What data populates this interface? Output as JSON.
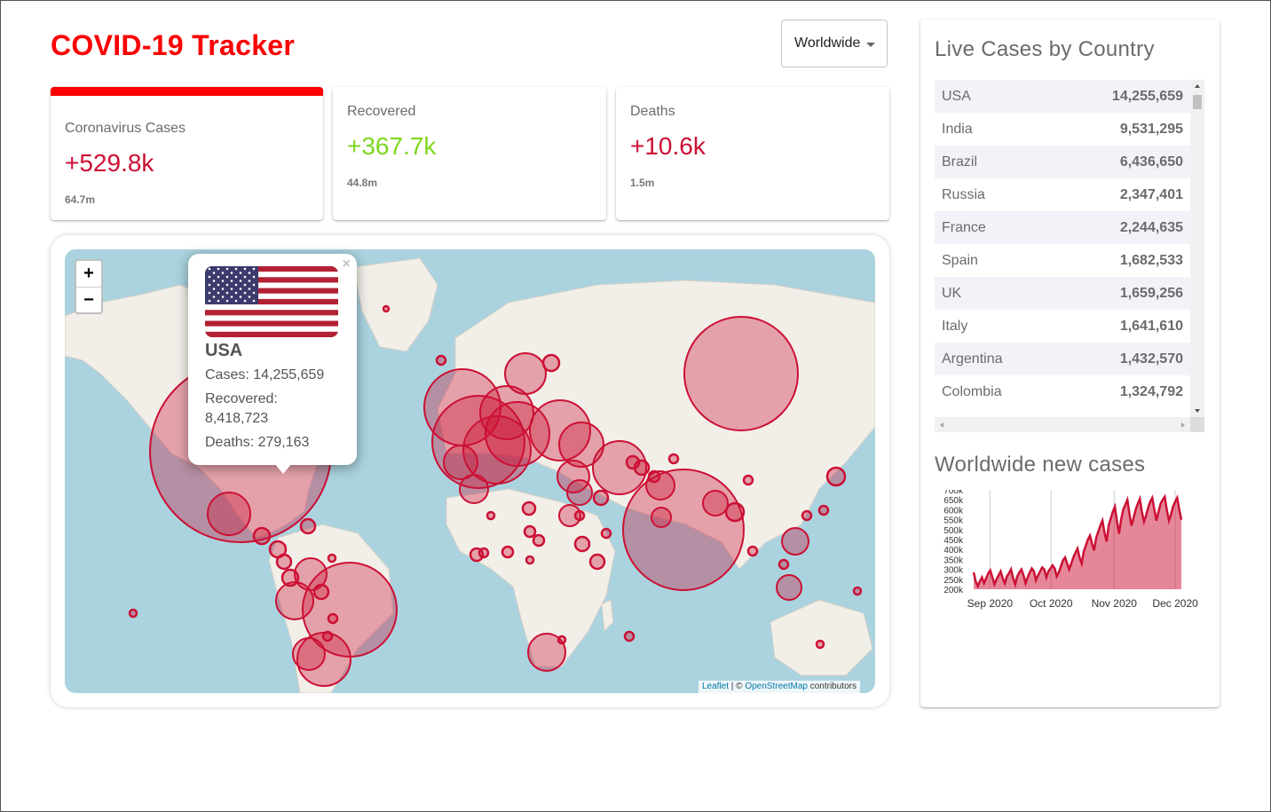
{
  "app": {
    "title": "COVID-19 Tracker"
  },
  "country_select": {
    "value": "Worldwide"
  },
  "info_cards": [
    {
      "title": "Coronavirus Cases",
      "today": "+529.8k",
      "total": "64.7m",
      "color": "#cc1034",
      "selected": true
    },
    {
      "title": "Recovered",
      "today": "+367.7k",
      "total": "44.8m",
      "color": "#7dd71d",
      "selected": false
    },
    {
      "title": "Deaths",
      "today": "+10.6k",
      "total": "1.5m",
      "color": "#cc1034",
      "selected": false
    }
  ],
  "map": {
    "zoom_in": "+",
    "zoom_out": "−",
    "popup": {
      "close": "×",
      "country": "USA",
      "cases": "Cases: 14,255,659",
      "recovered_line1": "Recovered:",
      "recovered_line2": "8,418,723",
      "deaths": "Deaths: 279,163"
    },
    "attribution": {
      "leaflet": "Leaflet",
      "sep": " | © ",
      "osm": "OpenStreetMap",
      "suffix": " contributors"
    },
    "circle_color": "#cc1034"
  },
  "sidebar": {
    "table_title": "Live Cases by Country",
    "countries": [
      {
        "name": "USA",
        "cases": "14,255,659"
      },
      {
        "name": "India",
        "cases": "9,531,295"
      },
      {
        "name": "Brazil",
        "cases": "6,436,650"
      },
      {
        "name": "Russia",
        "cases": "2,347,401"
      },
      {
        "name": "France",
        "cases": "2,244,635"
      },
      {
        "name": "Spain",
        "cases": "1,682,533"
      },
      {
        "name": "UK",
        "cases": "1,659,256"
      },
      {
        "name": "Italy",
        "cases": "1,641,610"
      },
      {
        "name": "Argentina",
        "cases": "1,432,570"
      },
      {
        "name": "Colombia",
        "cases": "1,324,792"
      }
    ],
    "chart_title": "Worldwide new cases"
  },
  "chart_data": {
    "type": "area",
    "title": "",
    "xlabel": "",
    "ylabel": "",
    "x_ticks": [
      "Sep 2020",
      "Oct 2020",
      "Nov 2020",
      "Dec 2020"
    ],
    "y_ticks": [
      "700k",
      "650k",
      "600k",
      "550k",
      "500k",
      "450k",
      "400k",
      "350k",
      "300k",
      "250k",
      "200k"
    ],
    "ylim": [
      200000,
      700000
    ],
    "x_range": [
      "2020-08-24",
      "2020-12-04"
    ],
    "x_tick_dates": [
      "2020-09-01",
      "2020-10-01",
      "2020-11-01",
      "2020-12-01"
    ],
    "color": "#cc1034",
    "series": [
      {
        "values": [
          285000,
          240000,
          215000,
          240000,
          260000,
          230000,
          255000,
          280000,
          295000,
          260000,
          225000,
          250000,
          270000,
          290000,
          255000,
          230000,
          265000,
          280000,
          300000,
          255000,
          225000,
          265000,
          285000,
          300000,
          270000,
          230000,
          260000,
          285000,
          305000,
          290000,
          245000,
          270000,
          290000,
          310000,
          300000,
          260000,
          290000,
          305000,
          320000,
          305000,
          265000,
          285000,
          315000,
          345000,
          360000,
          330000,
          300000,
          330000,
          360000,
          385000,
          405000,
          360000,
          330000,
          390000,
          420000,
          450000,
          470000,
          430000,
          395000,
          460000,
          490000,
          520000,
          545000,
          485000,
          440000,
          520000,
          555000,
          590000,
          615000,
          540000,
          480000,
          550000,
          600000,
          625000,
          650000,
          580000,
          520000,
          560000,
          600000,
          630000,
          655000,
          590000,
          540000,
          570000,
          610000,
          640000,
          660000,
          600000,
          545000,
          590000,
          630000,
          650000,
          665000,
          600000,
          545000,
          575000,
          615000,
          640000,
          660000,
          600000,
          550000
        ]
      }
    ]
  }
}
